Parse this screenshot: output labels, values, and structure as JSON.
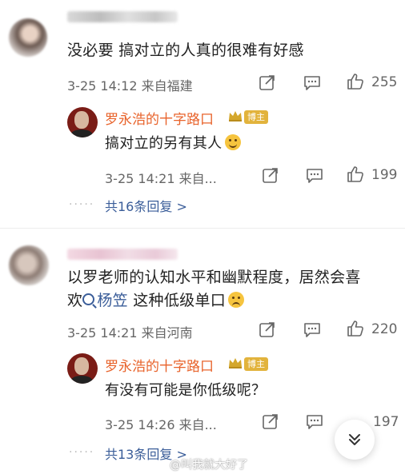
{
  "comments": [
    {
      "text": "没必要   搞对立的人真的很难有好感",
      "meta": "3-25 14:12 来自福建",
      "like_count": "255",
      "reply": {
        "author": "罗永浩的十字路口",
        "badge": "博主",
        "text": "搞对立的另有其人",
        "meta": "3-25 14:21 来自...",
        "like_count": "199"
      },
      "more_replies": "共16条回复 >"
    },
    {
      "text_line1": "以罗老师的认知水平和幽默程度，居然会喜",
      "text_line2_prefix": "欢",
      "topic": "杨笠",
      "text_line2_suffix": " 这种低级单口",
      "meta": "3-25 14:21 来自河南",
      "like_count": "220",
      "reply": {
        "author": "罗永浩的十字路口",
        "badge": "博主",
        "text": "有没有可能是你低级呢？",
        "meta": "3-25 14:26 来自...",
        "like_count": "197"
      },
      "more_replies": "共13条回复 >"
    }
  ],
  "watermark": "@叫我就大好了",
  "icons": [
    "share-icon",
    "comment-icon",
    "like-icon",
    "crown-icon",
    "scroll-down-icon",
    "search-icon"
  ],
  "colors": {
    "author": "#e8632b",
    "link": "#3a5d99",
    "badge": "#e2b33c",
    "meta": "#666666"
  }
}
